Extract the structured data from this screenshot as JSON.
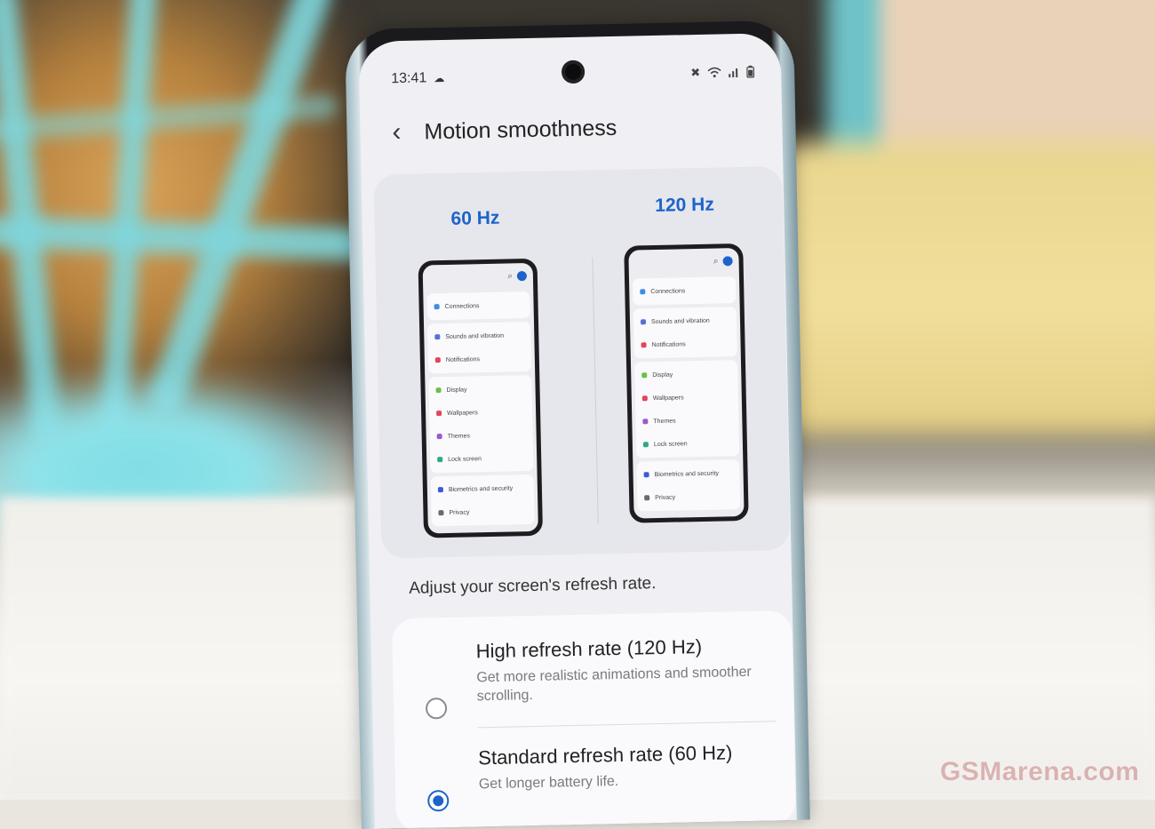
{
  "status_bar": {
    "time": "13:41",
    "indicators": [
      "mute-icon",
      "wifi-icon",
      "signal-icon",
      "battery-icon"
    ]
  },
  "header": {
    "back_icon": "chevron-left-icon",
    "title": "Motion smoothness"
  },
  "preview": {
    "left_label": "60 Hz",
    "right_label": "120 Hz",
    "left_items": [
      [
        "Connections"
      ],
      [
        "Sounds and vibration",
        "Notifications"
      ],
      [
        "Display",
        "Wallpapers",
        "Themes",
        "Lock screen"
      ],
      [
        "Biometrics and security",
        "Privacy"
      ]
    ],
    "right_items": [
      [
        "Connections"
      ],
      [
        "Sounds and vibration",
        "Notifications"
      ],
      [
        "Display",
        "Wallpapers",
        "Themes",
        "Lock screen"
      ],
      [
        "Biometrics and security",
        "Privacy"
      ]
    ]
  },
  "hint": "Adjust your screen's refresh rate.",
  "options": [
    {
      "title": "High refresh rate (120 Hz)",
      "description": "Get more realistic animations and smoother scrolling.",
      "selected": false
    },
    {
      "title": "Standard refresh rate (60 Hz)",
      "description": "Get longer battery life.",
      "selected": true
    }
  ],
  "colors": {
    "accent": "#1d63c9"
  },
  "watermark": "GSMarena.com"
}
